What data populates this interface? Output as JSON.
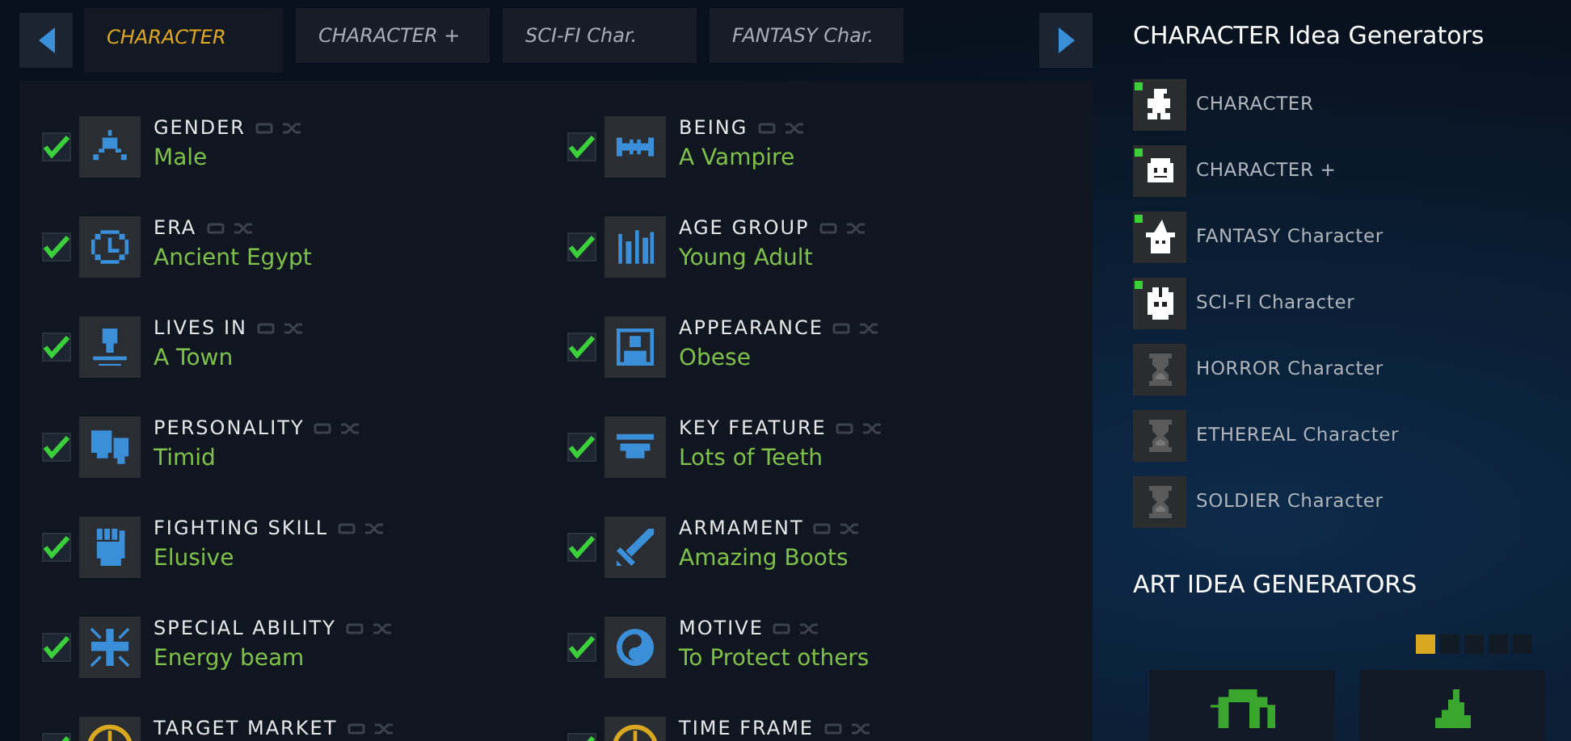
{
  "tabs": [
    {
      "label": "CHARACTER",
      "selected": true
    },
    {
      "label": "CHARACTER +",
      "selected": false
    },
    {
      "label": "SCI-FI Char.",
      "selected": false
    },
    {
      "label": "FANTASY Char.",
      "selected": false
    }
  ],
  "fields": [
    {
      "label": "GENDER",
      "value": "Male",
      "checked": true,
      "color": "#3b8fd9"
    },
    {
      "label": "BEING",
      "value": "A Vampire",
      "checked": true,
      "color": "#3b8fd9"
    },
    {
      "label": "ERA",
      "value": "Ancient Egypt",
      "checked": true,
      "color": "#3b8fd9"
    },
    {
      "label": "AGE GROUP",
      "value": "Young Adult",
      "checked": true,
      "color": "#3b8fd9"
    },
    {
      "label": "LIVES IN",
      "value": "A Town",
      "checked": true,
      "color": "#3b8fd9"
    },
    {
      "label": "APPEARANCE",
      "value": "Obese",
      "checked": true,
      "color": "#3b8fd9"
    },
    {
      "label": "PERSONALITY",
      "value": "Timid",
      "checked": true,
      "color": "#3b8fd9"
    },
    {
      "label": "KEY FEATURE",
      "value": "Lots of Teeth",
      "checked": true,
      "color": "#3b8fd9"
    },
    {
      "label": "FIGHTING SKILL",
      "value": "Elusive",
      "checked": true,
      "color": "#3b8fd9"
    },
    {
      "label": "ARMAMENT",
      "value": "Amazing Boots",
      "checked": true,
      "color": "#3b8fd9"
    },
    {
      "label": "SPECIAL ABILITY",
      "value": "Energy beam",
      "checked": true,
      "color": "#3b8fd9"
    },
    {
      "label": "MOTIVE",
      "value": "To Protect others",
      "checked": true,
      "color": "#3b8fd9"
    },
    {
      "label": "TARGET MARKET",
      "checked": true,
      "color": "#d9a820"
    },
    {
      "label": "TIME FRAME",
      "checked": true,
      "color": "#d9a820"
    }
  ],
  "sidebar": {
    "title": "CHARACTER Idea Generators",
    "generators": [
      {
        "label": "CHARACTER",
        "unlocked": true
      },
      {
        "label": "CHARACTER +",
        "unlocked": true
      },
      {
        "label": "FANTASY Character",
        "unlocked": true
      },
      {
        "label": "SCI-FI Character",
        "unlocked": true
      },
      {
        "label": "HORROR Character",
        "unlocked": false
      },
      {
        "label": "ETHEREAL Character",
        "unlocked": false
      },
      {
        "label": "SOLDIER Character",
        "unlocked": false
      }
    ],
    "art_title": "ART IDEA GENERATORS",
    "pager": [
      {
        "selected": true
      },
      {
        "selected": false
      },
      {
        "selected": false
      },
      {
        "selected": false
      },
      {
        "selected": false
      }
    ]
  }
}
